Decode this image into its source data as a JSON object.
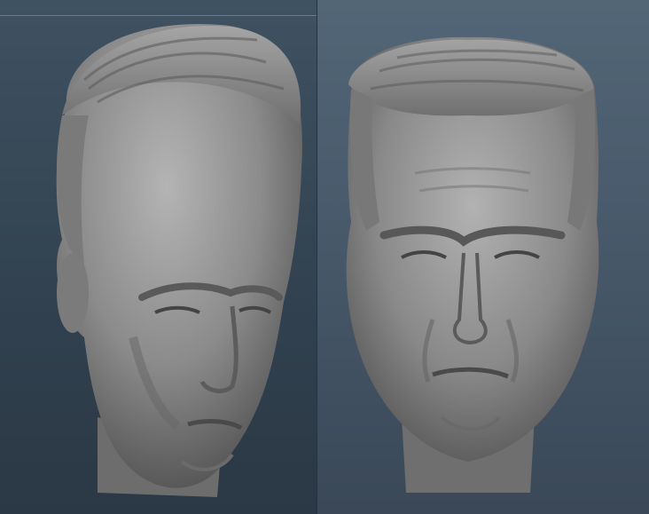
{
  "viewport": {
    "panels": [
      {
        "mesh": "head-sculpt-three-quarter",
        "material_color": "#8f8f8f",
        "background_top": "#3f5261",
        "background_bottom": "#2b3845"
      },
      {
        "mesh": "head-sculpt-front",
        "material_color": "#8c8c8c",
        "background_top": "#526677",
        "background_bottom": "#3a4857"
      }
    ]
  }
}
